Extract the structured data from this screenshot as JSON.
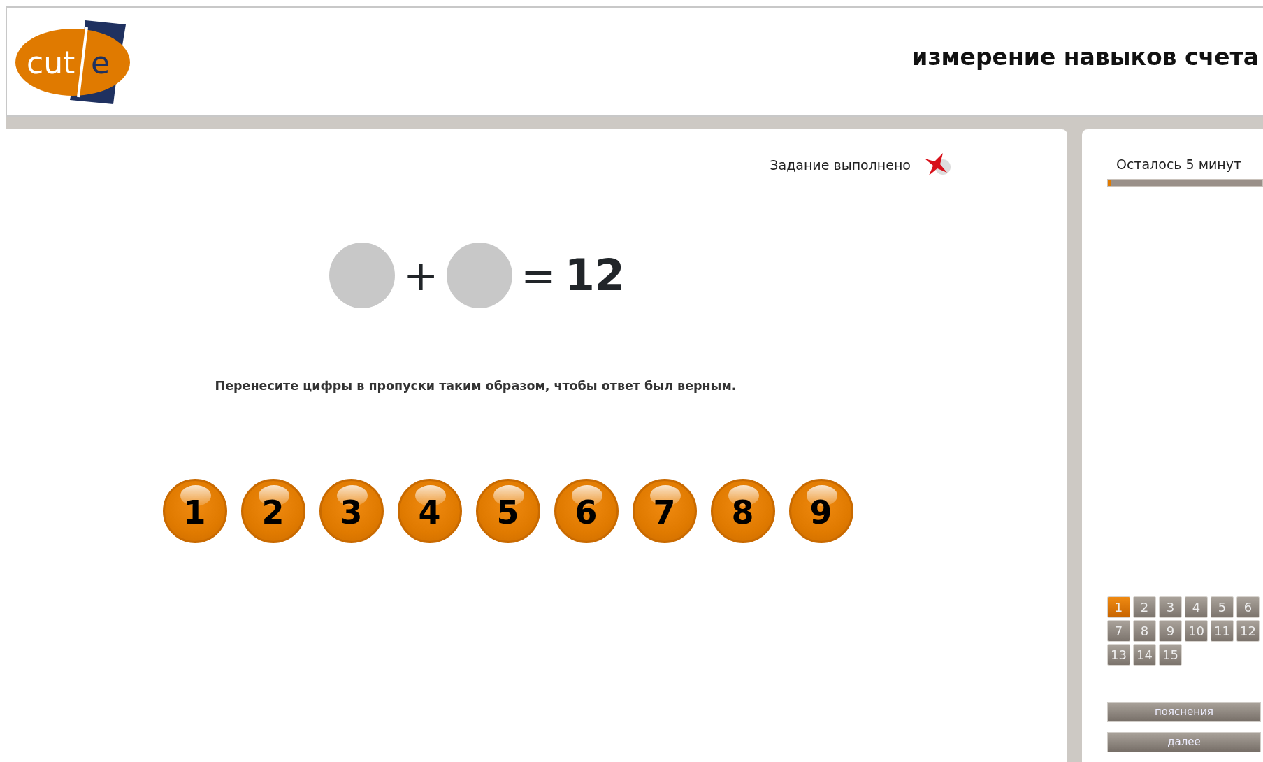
{
  "header": {
    "logo": {
      "left": "cut",
      "right": "e"
    },
    "title": "измерение навыков счета"
  },
  "task": {
    "status": "Задание выполнено"
  },
  "equation": [
    {
      "kind": "slot"
    },
    {
      "kind": "operator",
      "text": "+"
    },
    {
      "kind": "slot"
    },
    {
      "kind": "operator",
      "text": "="
    },
    {
      "kind": "result",
      "text": "12"
    }
  ],
  "instruction": "Перенесите цифры в пропуски таким образом, чтобы ответ был верным.",
  "digits": [
    "1",
    "2",
    "3",
    "4",
    "5",
    "6",
    "7",
    "8",
    "9"
  ],
  "sidebar": {
    "timer": {
      "text": "Осталось 5 минут",
      "level": 0.02
    },
    "questions": [
      {
        "label": "1",
        "selected": true
      },
      {
        "label": "2",
        "selected": false
      },
      {
        "label": "3",
        "selected": false
      },
      {
        "label": "4",
        "selected": false
      },
      {
        "label": "5",
        "selected": false
      },
      {
        "label": "6",
        "selected": false
      },
      {
        "label": "7",
        "selected": false
      },
      {
        "label": "8",
        "selected": false
      },
      {
        "label": "9",
        "selected": false
      },
      {
        "label": "10",
        "selected": false
      },
      {
        "label": "11",
        "selected": false
      },
      {
        "label": "12",
        "selected": false
      },
      {
        "label": "13",
        "selected": false
      },
      {
        "label": "14",
        "selected": false
      },
      {
        "label": "15",
        "selected": false
      }
    ],
    "buttons": [
      "пояснения",
      "далее"
    ]
  }
}
